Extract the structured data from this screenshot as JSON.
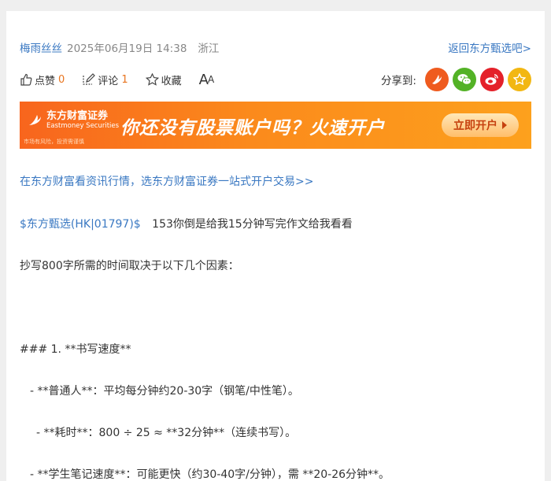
{
  "post": {
    "author": "梅雨丝丝",
    "datetime": "2025年06月19日 14:38",
    "location": "浙江",
    "back_link": "返回东方甄选吧>"
  },
  "actions": {
    "like_label": "点赞",
    "like_count": "0",
    "comment_label": "评论",
    "comment_count": "1",
    "favorite_label": "收藏",
    "font_size_label": "A",
    "font_size_small": "A",
    "share_label": "分享到:"
  },
  "share_targets": [
    {
      "icon": "eastmoney-icon",
      "color": "#ef5b1f"
    },
    {
      "icon": "wechat-icon",
      "color": "#53b226"
    },
    {
      "icon": "weibo-icon",
      "color": "#e4212a"
    },
    {
      "icon": "star-icon",
      "color": "#f2b712"
    }
  ],
  "banner": {
    "brand": "东方财富证券",
    "brand_en": "Eastmoney Securities",
    "disclaimer": "市场有风险，投资需谨慎",
    "headline": "你还没有股票账户吗？火速开户",
    "button": "立即开户"
  },
  "promo_link": "在东方财富看资讯行情，选东方财富证券一站式开户交易>>",
  "content": {
    "stock_tag": "$东方甄选(HK|01797)$",
    "first_line": "153你倒是给我15分钟写完作文给我看看",
    "paragraphs": [
      "抄写800字所需的时间取决于以下几个因素：",
      "### 1. **书写速度**",
      "- **普通人**：平均每分钟约20-30字（钢笔/中性笔）。",
      "- **耗时**：800 ÷ 25 ≈ **32分钟**（连续书写）。",
      "- **学生笔记速度**：可能更快（约30-40字/分钟），需 **20-26分钟**。"
    ]
  }
}
